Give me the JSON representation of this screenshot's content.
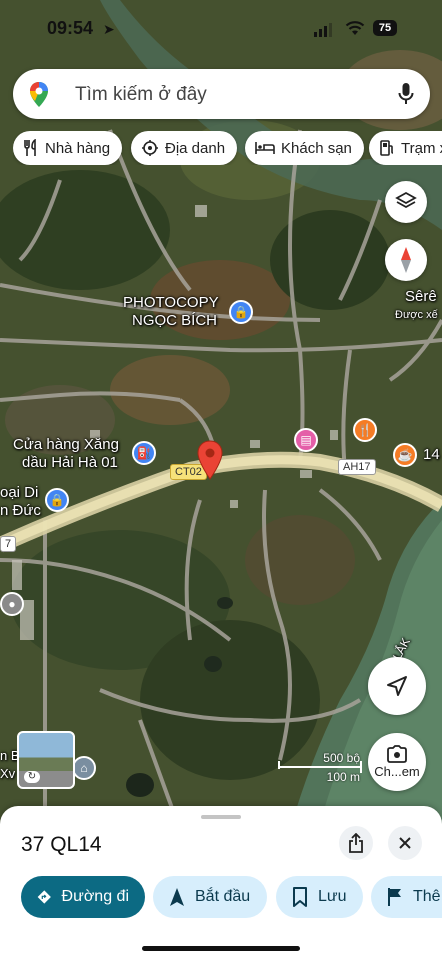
{
  "status_bar": {
    "time": "09:54",
    "battery": "75"
  },
  "search": {
    "placeholder": "Tìm kiếm ở đây"
  },
  "chips": [
    {
      "label": "Nhà hàng",
      "icon": "fork-knife-icon"
    },
    {
      "label": "Địa danh",
      "icon": "landmark-icon"
    },
    {
      "label": "Khách sạn",
      "icon": "bed-icon"
    },
    {
      "label": "Trạm x",
      "icon": "gas-pump-icon"
    }
  ],
  "map": {
    "labels": {
      "photocopy": [
        "PHOTOCOPY",
        "NGỌC BÍCH"
      ],
      "gas_store": [
        "Cửa hàng Xăng",
        "dầu Hải Hà 01"
      ],
      "left_place": [
        "oại Di",
        "n Đức"
      ],
      "sere": [
        "Sêrê",
        "Được xế"
      ],
      "num_14": "14",
      "river": "LẮK",
      "bottom_left": [
        "n B",
        "Xv"
      ]
    },
    "shields": {
      "ct02": "CT02",
      "ah17": "AH17",
      "edge": "7"
    },
    "colors": {
      "pin": "#ea4335",
      "shopping": "#4285f4",
      "hotel": "#e45ea8",
      "food": "#f57c26"
    }
  },
  "camera_button": {
    "label": "Ch...em"
  },
  "scale": {
    "feet": "500 bộ",
    "meters": "100 m"
  },
  "sheet": {
    "title": "37 QL14",
    "actions": [
      {
        "label": "Đường đi",
        "icon": "directions-icon"
      },
      {
        "label": "Bắt đầu",
        "icon": "navigation-arrow-icon"
      },
      {
        "label": "Lưu",
        "icon": "bookmark-icon"
      },
      {
        "label": "Thê",
        "icon": "flag-icon"
      }
    ]
  }
}
